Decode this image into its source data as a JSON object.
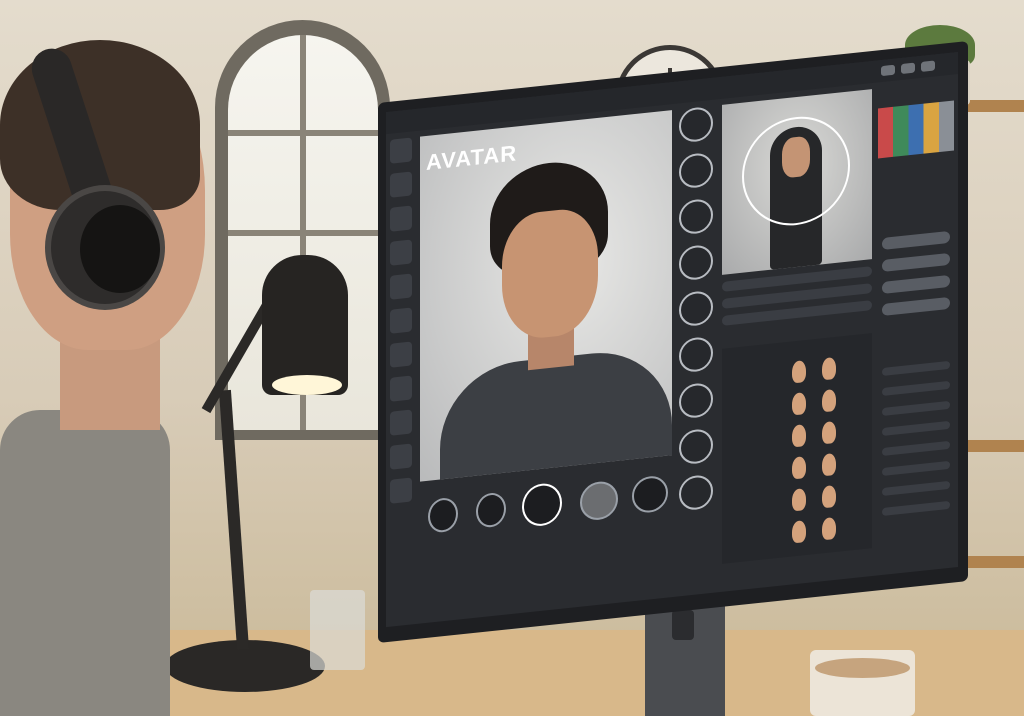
{
  "app": {
    "title": "AVATAR"
  },
  "icons": {
    "window_controls": [
      "minimize-icon",
      "maximize-icon",
      "close-icon"
    ],
    "bottom_controls": [
      "camera-icon",
      "rotate-icon",
      "record-icon",
      "face-icon",
      "settings-icon"
    ]
  },
  "colors": {
    "screen_background": "#2a2c30",
    "accent": "#ffffff"
  }
}
